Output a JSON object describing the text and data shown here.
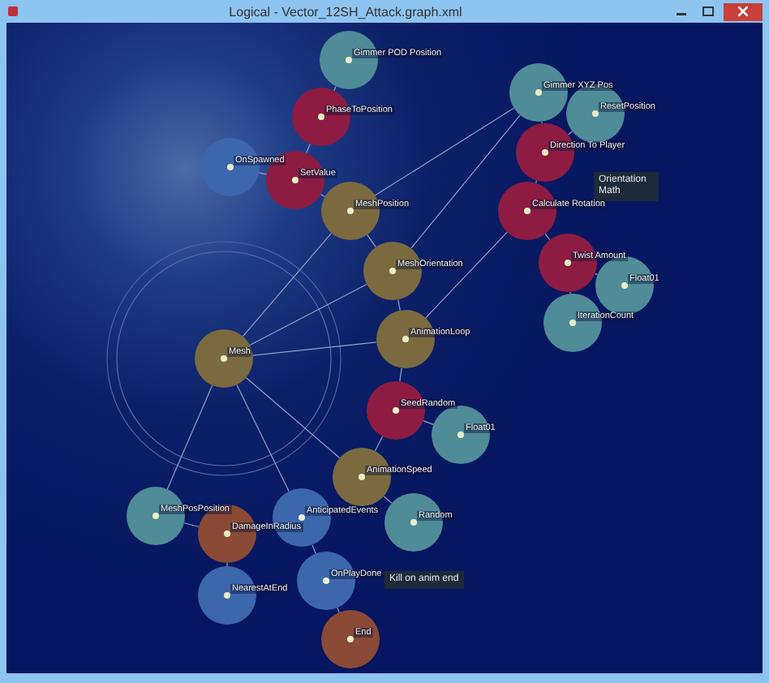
{
  "window": {
    "title": "Logical - Vector_12SH_Attack.graph.xml"
  },
  "nodes": [
    {
      "label": "Gimmer POD Position",
      "color": "#4f8c98"
    },
    {
      "label": "PhaseToPosition",
      "color": "#8e1c42"
    },
    {
      "label": "OnSpawned",
      "color": "#3c67ad"
    },
    {
      "label": "SetValue",
      "color": "#8e1c42"
    },
    {
      "label": "MeshPosition",
      "color": "#7b6a40"
    },
    {
      "label": "MeshOrientation",
      "color": "#7b6a40"
    },
    {
      "label": "AnimationLoop",
      "color": "#7b6a40"
    },
    {
      "label": "Mesh",
      "color": "#7b6a40"
    },
    {
      "label": "SeedRandom",
      "color": "#8e1c42"
    },
    {
      "label": "Float01",
      "color": "#4f8c98"
    },
    {
      "label": "AnimationSpeed",
      "color": "#7b6a40"
    },
    {
      "label": "MeshPosPosition",
      "color": "#4f8c98"
    },
    {
      "label": "DamageInRadius",
      "color": "#8a4a36"
    },
    {
      "label": "AnticipatedEvents",
      "color": "#3c67ad"
    },
    {
      "label": "Random",
      "color": "#4f8c98"
    },
    {
      "label": "OnPlayDone",
      "color": "#3c67ad"
    },
    {
      "label": "NearestAtEnd",
      "color": "#3c67ad"
    },
    {
      "label": "End",
      "color": "#8a4a36"
    },
    {
      "label": "Gimmer XYZ Pos",
      "color": "#4f8c98"
    },
    {
      "label": "ResetPosition",
      "color": "#4f8c98"
    },
    {
      "label": "Direction To Player",
      "color": "#8e1c42"
    },
    {
      "label": "Calculate Rotation",
      "color": "#8e1c42"
    },
    {
      "label": "Twist Amount",
      "color": "#8e1c42"
    },
    {
      "label": "Float01",
      "color": "#4f8c98"
    },
    {
      "label": "IterationCount",
      "color": "#4f8c98"
    }
  ],
  "notes": [
    {
      "text": "Orientation Math"
    },
    {
      "text": "Kill on anim end"
    }
  ]
}
